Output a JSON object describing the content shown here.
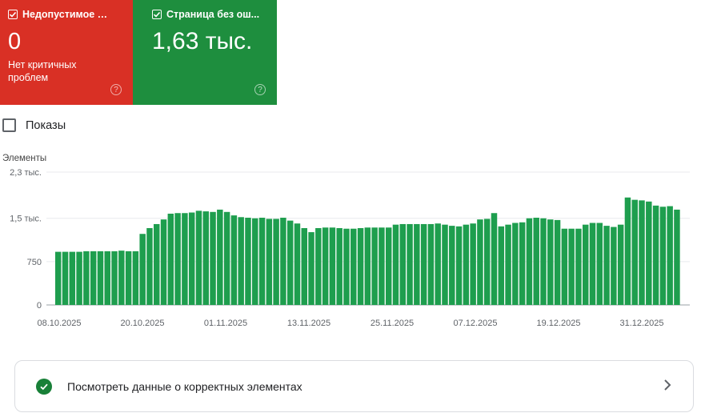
{
  "cards": [
    {
      "title": "Недопустимое з...",
      "value": "0",
      "subtitle": "Нет критичных проблем",
      "color": "#d93025"
    },
    {
      "title": "Страница без ош...",
      "value": "1,63 тыс.",
      "color": "#1e8e3e"
    }
  ],
  "impressions_label": "Показы",
  "chart_data": {
    "type": "bar",
    "title": "",
    "ylabel": "Элементы",
    "xlabel": "",
    "ylim": [
      0,
      2300
    ],
    "yticks": [
      "2,3 тыс.",
      "1,5 тыс.",
      "750",
      "0"
    ],
    "ytick_values": [
      2300,
      1500,
      750,
      0
    ],
    "x_tick_labels": [
      "08.10.2025",
      "20.10.2025",
      "01.11.2025",
      "13.11.2025",
      "25.11.2025",
      "07.12.2025",
      "19.12.2025",
      "31.12.2025"
    ],
    "bar_color": "#1e9e4e",
    "values": [
      920,
      920,
      920,
      920,
      930,
      930,
      930,
      930,
      930,
      940,
      930,
      930,
      1230,
      1330,
      1400,
      1480,
      1580,
      1590,
      1590,
      1600,
      1630,
      1620,
      1610,
      1650,
      1610,
      1550,
      1520,
      1510,
      1500,
      1510,
      1490,
      1490,
      1510,
      1460,
      1410,
      1330,
      1260,
      1330,
      1340,
      1340,
      1330,
      1320,
      1320,
      1330,
      1340,
      1340,
      1340,
      1340,
      1390,
      1400,
      1400,
      1400,
      1400,
      1400,
      1410,
      1390,
      1370,
      1360,
      1390,
      1410,
      1480,
      1490,
      1590,
      1360,
      1390,
      1420,
      1430,
      1500,
      1510,
      1500,
      1480,
      1470,
      1320,
      1320,
      1320,
      1390,
      1420,
      1420,
      1370,
      1350,
      1390,
      1860,
      1820,
      1810,
      1790,
      1720,
      1700,
      1710,
      1650
    ]
  },
  "link": {
    "label": "Посмотреть данные о корректных элементах"
  }
}
